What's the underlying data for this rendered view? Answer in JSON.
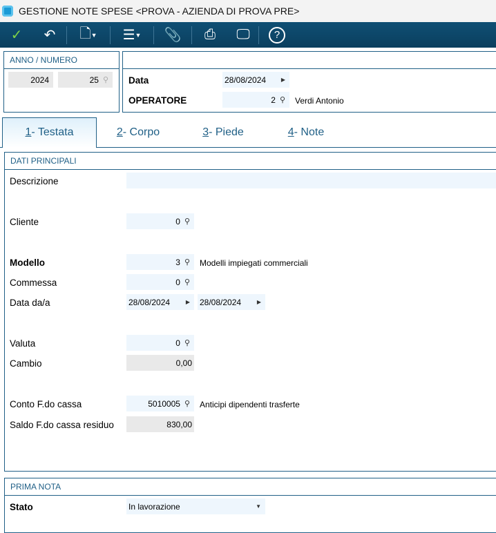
{
  "window": {
    "title": "GESTIONE NOTE SPESE <PROVA - AZIENDA DI PROVA PRE>"
  },
  "toolbar": {
    "icons": [
      "check-icon",
      "undo-icon",
      "document-icon",
      "menu-icon",
      "paperclip-icon",
      "print-icon",
      "monitor-icon",
      "help-icon"
    ],
    "accent": "#0f4f74"
  },
  "header": {
    "anno_numero_title": "ANNO / NUMERO",
    "anno": "2024",
    "numero": "25",
    "data_label": "Data",
    "data_value": "28/08/2024",
    "operatore_label": "OPERATORE",
    "operatore_value": "2",
    "operatore_name": "Verdi Antonio"
  },
  "tabs": [
    {
      "num": "1",
      "label": " - Testata"
    },
    {
      "num": "2",
      "label": " - Corpo"
    },
    {
      "num": "3",
      "label": " - Piede"
    },
    {
      "num": "4",
      "label": " - Note"
    }
  ],
  "dati": {
    "title": "DATI PRINCIPALI",
    "descrizione_label": "Descrizione",
    "descrizione_value": "",
    "cliente_label": "Cliente",
    "cliente_value": "0",
    "modello_label": "Modello",
    "modello_value": "3",
    "modello_desc": "Modelli impiegati commerciali",
    "commessa_label": "Commessa",
    "commessa_value": "0",
    "data_label": "Data da/a",
    "data_da": "28/08/2024",
    "data_a": "28/08/2024",
    "valuta_label": "Valuta",
    "valuta_value": "0",
    "cambio_label": "Cambio",
    "cambio_value": "0,00",
    "conto_label": "Conto F.do cassa",
    "conto_value": "5010005",
    "conto_desc": "Anticipi dipendenti trasferte",
    "saldo_label": "Saldo F.do cassa residuo",
    "saldo_value": "830,00"
  },
  "prima_nota": {
    "title": "PRIMA NOTA",
    "stato_label": "Stato",
    "stato_value": "In lavorazione"
  }
}
